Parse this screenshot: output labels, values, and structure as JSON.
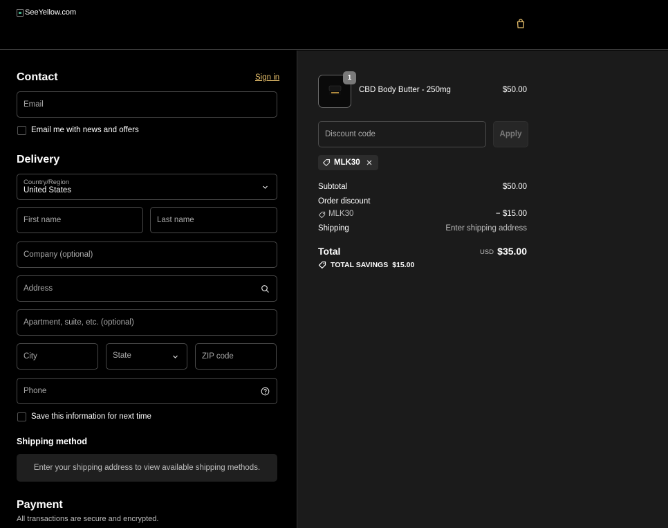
{
  "header": {
    "logo_alt": "SeeYellow.com",
    "cart_icon": "shopping-bag-icon"
  },
  "contact": {
    "title": "Contact",
    "sign_in": "Sign in",
    "email_placeholder": "Email",
    "news_checkbox_label": "Email me with news and offers"
  },
  "delivery": {
    "title": "Delivery",
    "country_label": "Country/Region",
    "country_value": "United States",
    "first_name": "First name",
    "last_name": "Last name",
    "company": "Company (optional)",
    "address": "Address",
    "apartment": "Apartment, suite, etc. (optional)",
    "city": "City",
    "state": "State",
    "zip": "ZIP code",
    "phone": "Phone",
    "save_info_label": "Save this information for next time"
  },
  "shipping_method": {
    "title": "Shipping method",
    "notice": "Enter your shipping address to view available shipping methods."
  },
  "payment": {
    "title": "Payment",
    "subtitle": "All transactions are secure and encrypted."
  },
  "summary": {
    "item": {
      "name": "CBD Body Butter - 250mg",
      "price": "$50.00",
      "quantity": "1"
    },
    "discount_placeholder": "Discount code",
    "apply_label": "Apply",
    "applied_code": "MLK30",
    "subtotal_label": "Subtotal",
    "subtotal_value": "$50.00",
    "order_discount_label": "Order discount",
    "discount_code": "MLK30",
    "discount_value": "− $15.00",
    "shipping_label": "Shipping",
    "shipping_value": "Enter shipping address",
    "total_label": "Total",
    "currency": "USD",
    "total_value": "$35.00",
    "savings_label": "TOTAL SAVINGS",
    "savings_value": "$15.00"
  },
  "colors": {
    "accent_link": "#e8c06b",
    "background_left": "#000000",
    "background_right": "#1b1b1b"
  }
}
